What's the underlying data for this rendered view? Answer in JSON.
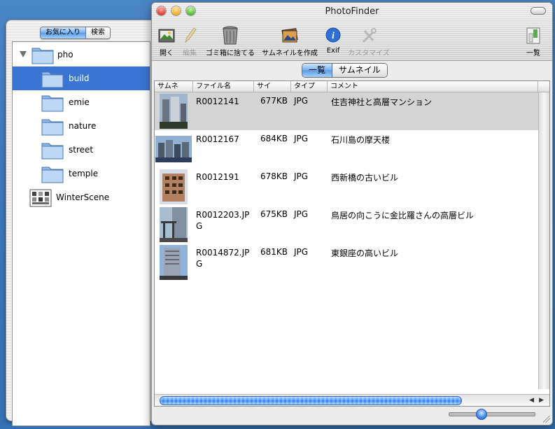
{
  "drawer": {
    "tabs": [
      {
        "label": "お気に入り",
        "active": true
      },
      {
        "label": "検索",
        "active": false
      }
    ],
    "tree": {
      "root": {
        "label": "pho",
        "expanded": true
      },
      "folders": [
        "build",
        "emie",
        "nature",
        "street",
        "temple"
      ],
      "selected": "build",
      "other": {
        "label": "WinterScene"
      }
    }
  },
  "window": {
    "title": "PhotoFinder",
    "toolbar": {
      "open": "開く",
      "edit": "編集",
      "trash": "ゴミ箱に捨てる",
      "make_thumbnail": "サムネイルを作成",
      "exif": "Exif",
      "customize": "カスタマイズ",
      "list": "一覧"
    },
    "view_tabs": [
      {
        "label": "一覧",
        "active": true
      },
      {
        "label": "サムネイル",
        "active": false
      }
    ],
    "columns": [
      "サムネ",
      "ファイル名",
      "サイ",
      "タイプ",
      "コメント"
    ],
    "rows": [
      {
        "filename": "R0012141",
        "size": "677KB",
        "type": "JPG",
        "comment": "住吉神社と高層マンション",
        "selected": true
      },
      {
        "filename": "R0012167",
        "size": "684KB",
        "type": "JPG",
        "comment": "石川島の摩天楼",
        "selected": false
      },
      {
        "filename": "R0012191",
        "size": "678KB",
        "type": "JPG",
        "comment": "西新橋の古いビル",
        "selected": false
      },
      {
        "filename": "R0012203.JPG",
        "size": "675KB",
        "type": "JPG",
        "comment": "鳥居の向こうに金比羅さんの高層ビル",
        "selected": false
      },
      {
        "filename": "R0014872.JPG",
        "size": "681KB",
        "type": "JPG",
        "comment": "東銀座の高いビル",
        "selected": false
      }
    ],
    "thumbnail_size": 0.35
  }
}
